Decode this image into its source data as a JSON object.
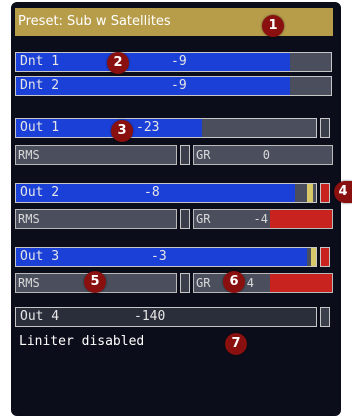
{
  "preset": {
    "title": "Preset: Sub w Satellites"
  },
  "dnt": [
    {
      "label": "Dnt 1",
      "value": "-9",
      "level": 0.87
    },
    {
      "label": "Dnt 2",
      "value": "-9",
      "level": 0.87
    }
  ],
  "outputs": [
    {
      "label": "Out 1",
      "value": "-23",
      "level": 0.62,
      "rms_label": "RMS",
      "gr_label": "GR",
      "gr_value": "0",
      "rms_level": 0.0,
      "gr_level": 0.0
    },
    {
      "label": "Out 2",
      "value": "-8",
      "level": 0.93,
      "rms_label": "RMS",
      "gr_label": "GR",
      "gr_value": "-4",
      "rms_level": 0.0,
      "gr_level": 0.45
    },
    {
      "label": "Out 3",
      "value": "-3",
      "level": 0.97,
      "rms_label": "RMS",
      "gr_label": "GR",
      "gr_value": "-4",
      "rms_level": 0.0,
      "gr_level": 0.45
    },
    {
      "label": "Out 4",
      "value": "-140",
      "level": 0.0
    }
  ],
  "status": {
    "limiter": "Liniter disabled"
  },
  "callouts": [
    "1",
    "2",
    "3",
    "4",
    "5",
    "6",
    "7"
  ],
  "colors": {
    "title_bg": "#b79d4a",
    "meter_fill": "#1b40d8",
    "meter_bg": "#4b4f5d",
    "gr_red": "#c8231e",
    "callout": "#8a1010"
  }
}
